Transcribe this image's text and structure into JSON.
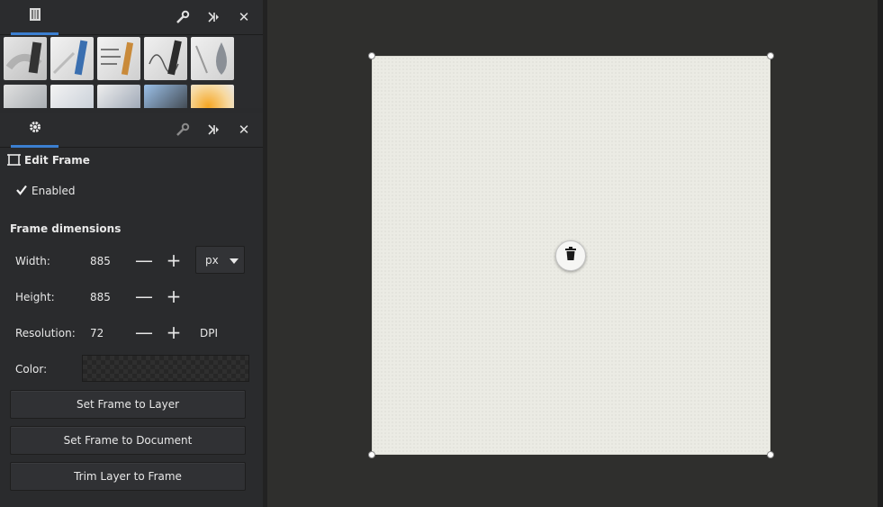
{
  "brush_panel": {
    "tab_icon": "brush-library-icon",
    "actions": [
      "wrench-icon",
      "dock-arrows-icon",
      "close-icon"
    ],
    "close_glyph": "✕",
    "brushes": [
      "smudge-brush",
      "marker-brush",
      "blue-pencil-brush",
      "pencil-brush",
      "technical-pen-brush",
      "ink-drop-brush",
      "airbrush-gray",
      "airbrush-blue",
      "texture-brush",
      "blue-paint-brush",
      "watercolor-blue",
      "watercolor-orange"
    ]
  },
  "settings_panel": {
    "tab_icon": "gear-icon",
    "actions": [
      "wrench-icon",
      "dock-arrows-icon",
      "close-icon"
    ],
    "close_glyph": "✕",
    "title": "Edit Frame",
    "enabled_label": "Enabled",
    "enabled": true,
    "section_title": "Frame dimensions",
    "fields": {
      "width_label": "Width:",
      "width_value": "885",
      "height_label": "Height:",
      "height_value": "885",
      "resolution_label": "Resolution:",
      "resolution_value": "72",
      "resolution_unit": "DPI",
      "color_label": "Color:"
    },
    "minus_glyph": "—",
    "plus_glyph": "+",
    "unit_select": "px",
    "buttons": {
      "set_frame_to_layer": "Set Frame to Layer",
      "set_frame_to_document": "Set Frame to Document",
      "trim_layer_to_frame": "Trim Layer to Frame"
    }
  },
  "canvas": {
    "frame_color": "#ebebe4",
    "background": "#2f2f2d",
    "center_icon": "trash-icon"
  },
  "colors": {
    "accent": "#3b7fd0",
    "panel_bg": "#2a2b2d"
  }
}
